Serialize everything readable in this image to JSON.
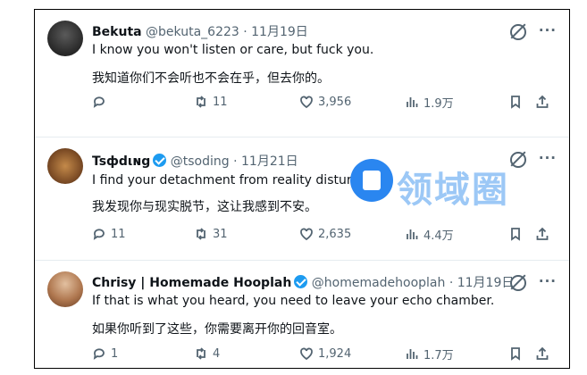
{
  "tweets": [
    {
      "name": "Bekuta",
      "handle": "@bekuta_6223",
      "date": "· 11月19日",
      "verified": false,
      "text_en": "I know you won't listen or care, but fuck you.",
      "text_cn": "我知道你们不会听也不会在乎，但去你的。",
      "replies": "",
      "retweets": "11",
      "likes": "3,956",
      "views": "1.9万"
    },
    {
      "name": "Tsфdιɴg",
      "handle": "@tsoding",
      "date": "· 11月21日",
      "verified": true,
      "text_en": "I find your detachment from reality disturbing.",
      "text_cn": "我发现你与现实脱节，这让我感到不安。",
      "replies": "11",
      "retweets": "31",
      "likes": "2,635",
      "views": "4.4万"
    },
    {
      "name": "Chrisy | Homemade Hooplah",
      "handle": "@homemadehooplah",
      "date": "· 11月19日",
      "verified": true,
      "text_en": "If that is what you heard, you need to leave your echo chamber.",
      "text_cn": "如果你听到了这些，你需要离开你的回音室。",
      "replies": "1",
      "retweets": "4",
      "likes": "1,924",
      "views": "1.7万"
    }
  ],
  "icons": {
    "more": "···",
    "grok": "grok-icon",
    "reply": "reply-icon",
    "retweet": "retweet-icon",
    "like": "heart-icon",
    "views": "views-icon",
    "bookmark": "bookmark-icon",
    "share": "share-icon"
  },
  "watermark": {
    "text": "领域圈"
  },
  "colors": {
    "accent": "#1d9bf0",
    "muted": "#536471",
    "text": "#0f1419"
  }
}
